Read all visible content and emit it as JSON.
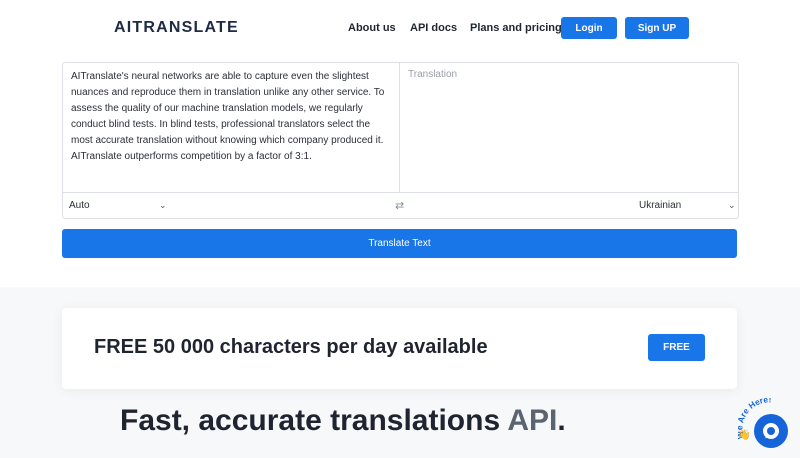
{
  "header": {
    "logo": "AITRANSLATE",
    "nav": [
      "About us",
      "API docs",
      "Plans and pricing"
    ],
    "login_label": "Login",
    "signup_label": "Sign UP"
  },
  "translator": {
    "source_text": "AITranslate's neural networks are able to capture even the slightest nuances and reproduce them in translation unlike any other service. To assess the quality of our machine translation models, we regularly conduct blind tests. In blind tests, professional translators select the most accurate translation without knowing which company produced it. AITranslate outperforms competition by a factor of 3:1.",
    "target_placeholder": "Translation",
    "source_lang": "Auto",
    "target_lang": "Ukrainian",
    "translate_label": "Translate Text"
  },
  "promo": {
    "text": "FREE 50 000 characters per day available",
    "button_label": "FREE"
  },
  "headline": {
    "main": "Fast, accurate translations ",
    "accent": "API",
    "end": "."
  },
  "chat_widget": {
    "badge_text": "We Are Here!",
    "accent_color": "#1565d8"
  },
  "colors": {
    "primary": "#1976e8"
  }
}
